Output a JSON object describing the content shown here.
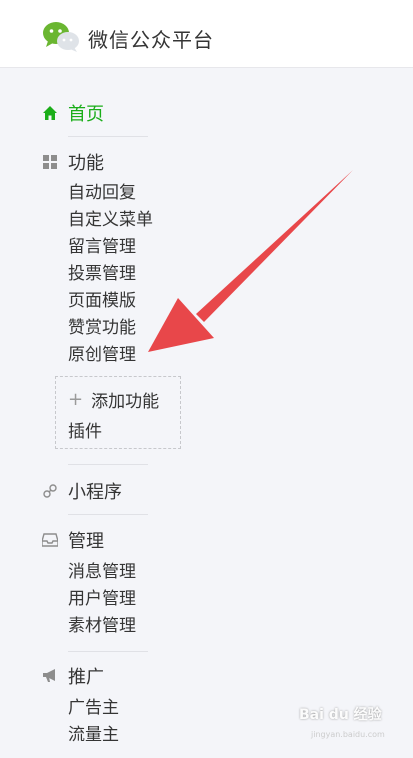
{
  "header": {
    "title": "微信公众平台"
  },
  "nav": {
    "home": {
      "label": "首页"
    },
    "features": {
      "label": "功能",
      "items": [
        "自动回复",
        "自定义菜单",
        "留言管理",
        "投票管理",
        "页面模版",
        "赞赏功能",
        "原创管理"
      ],
      "add_plugin": {
        "line1": "添加功能",
        "line2": "插件"
      }
    },
    "miniprogram": {
      "label": "小程序"
    },
    "manage": {
      "label": "管理",
      "items": [
        "消息管理",
        "用户管理",
        "素材管理"
      ]
    },
    "promote": {
      "label": "推广",
      "items": [
        "广告主",
        "流量主"
      ]
    }
  },
  "annotation": {
    "arrow_color": "#e8474a"
  },
  "watermark": {
    "text": "Bai du 经验",
    "sub": "jingyan.baidu.com"
  },
  "colors": {
    "accent": "#1aad19",
    "text": "#353535",
    "background": "#f4f5f9"
  }
}
